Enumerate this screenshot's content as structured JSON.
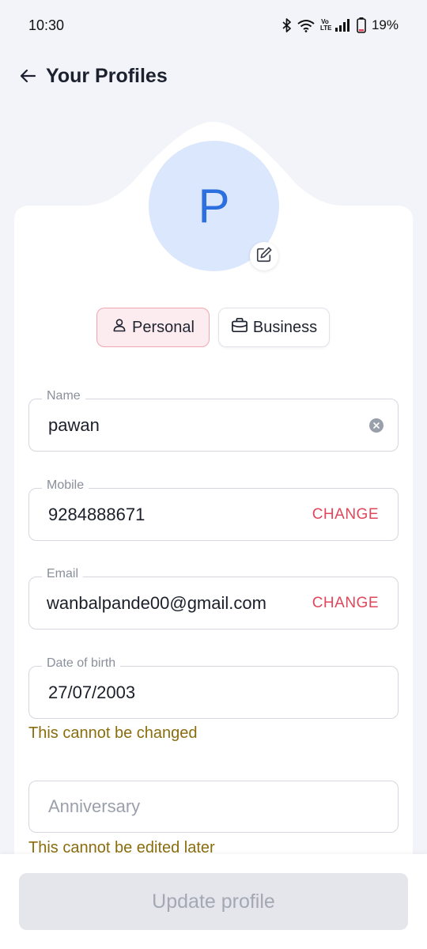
{
  "status_bar": {
    "time": "10:30",
    "battery": "19%",
    "icons": [
      "bluetooth-icon",
      "wifi-icon",
      "volte-icon",
      "signal-icon",
      "battery-icon"
    ]
  },
  "header": {
    "title": "Your Profiles",
    "back_icon": "arrow-left-icon"
  },
  "avatar": {
    "letter": "P",
    "edit_icon": "edit-icon"
  },
  "profile_tabs": {
    "personal": {
      "label": "Personal",
      "icon": "user-icon",
      "selected": true
    },
    "business": {
      "label": "Business",
      "icon": "briefcase-icon",
      "selected": false
    }
  },
  "form": {
    "name": {
      "label": "Name",
      "value": "pawan"
    },
    "mobile": {
      "label": "Mobile",
      "value": "9284888671",
      "action": "CHANGE"
    },
    "email": {
      "label": "Email",
      "value": "wanbalpande00@gmail.com",
      "action": "CHANGE"
    },
    "dob": {
      "label": "Date of birth",
      "value": "27/07/2003",
      "helper": "This cannot be changed"
    },
    "anniversary": {
      "placeholder": "Anniversary",
      "helper": "This cannot be edited later"
    }
  },
  "footer": {
    "update_label": "Update profile"
  },
  "colors": {
    "accent_red": "#e0475a",
    "helper_text": "#8a6d0d",
    "avatar_bg": "#dbe7fc",
    "avatar_letter": "#2c6fde"
  }
}
